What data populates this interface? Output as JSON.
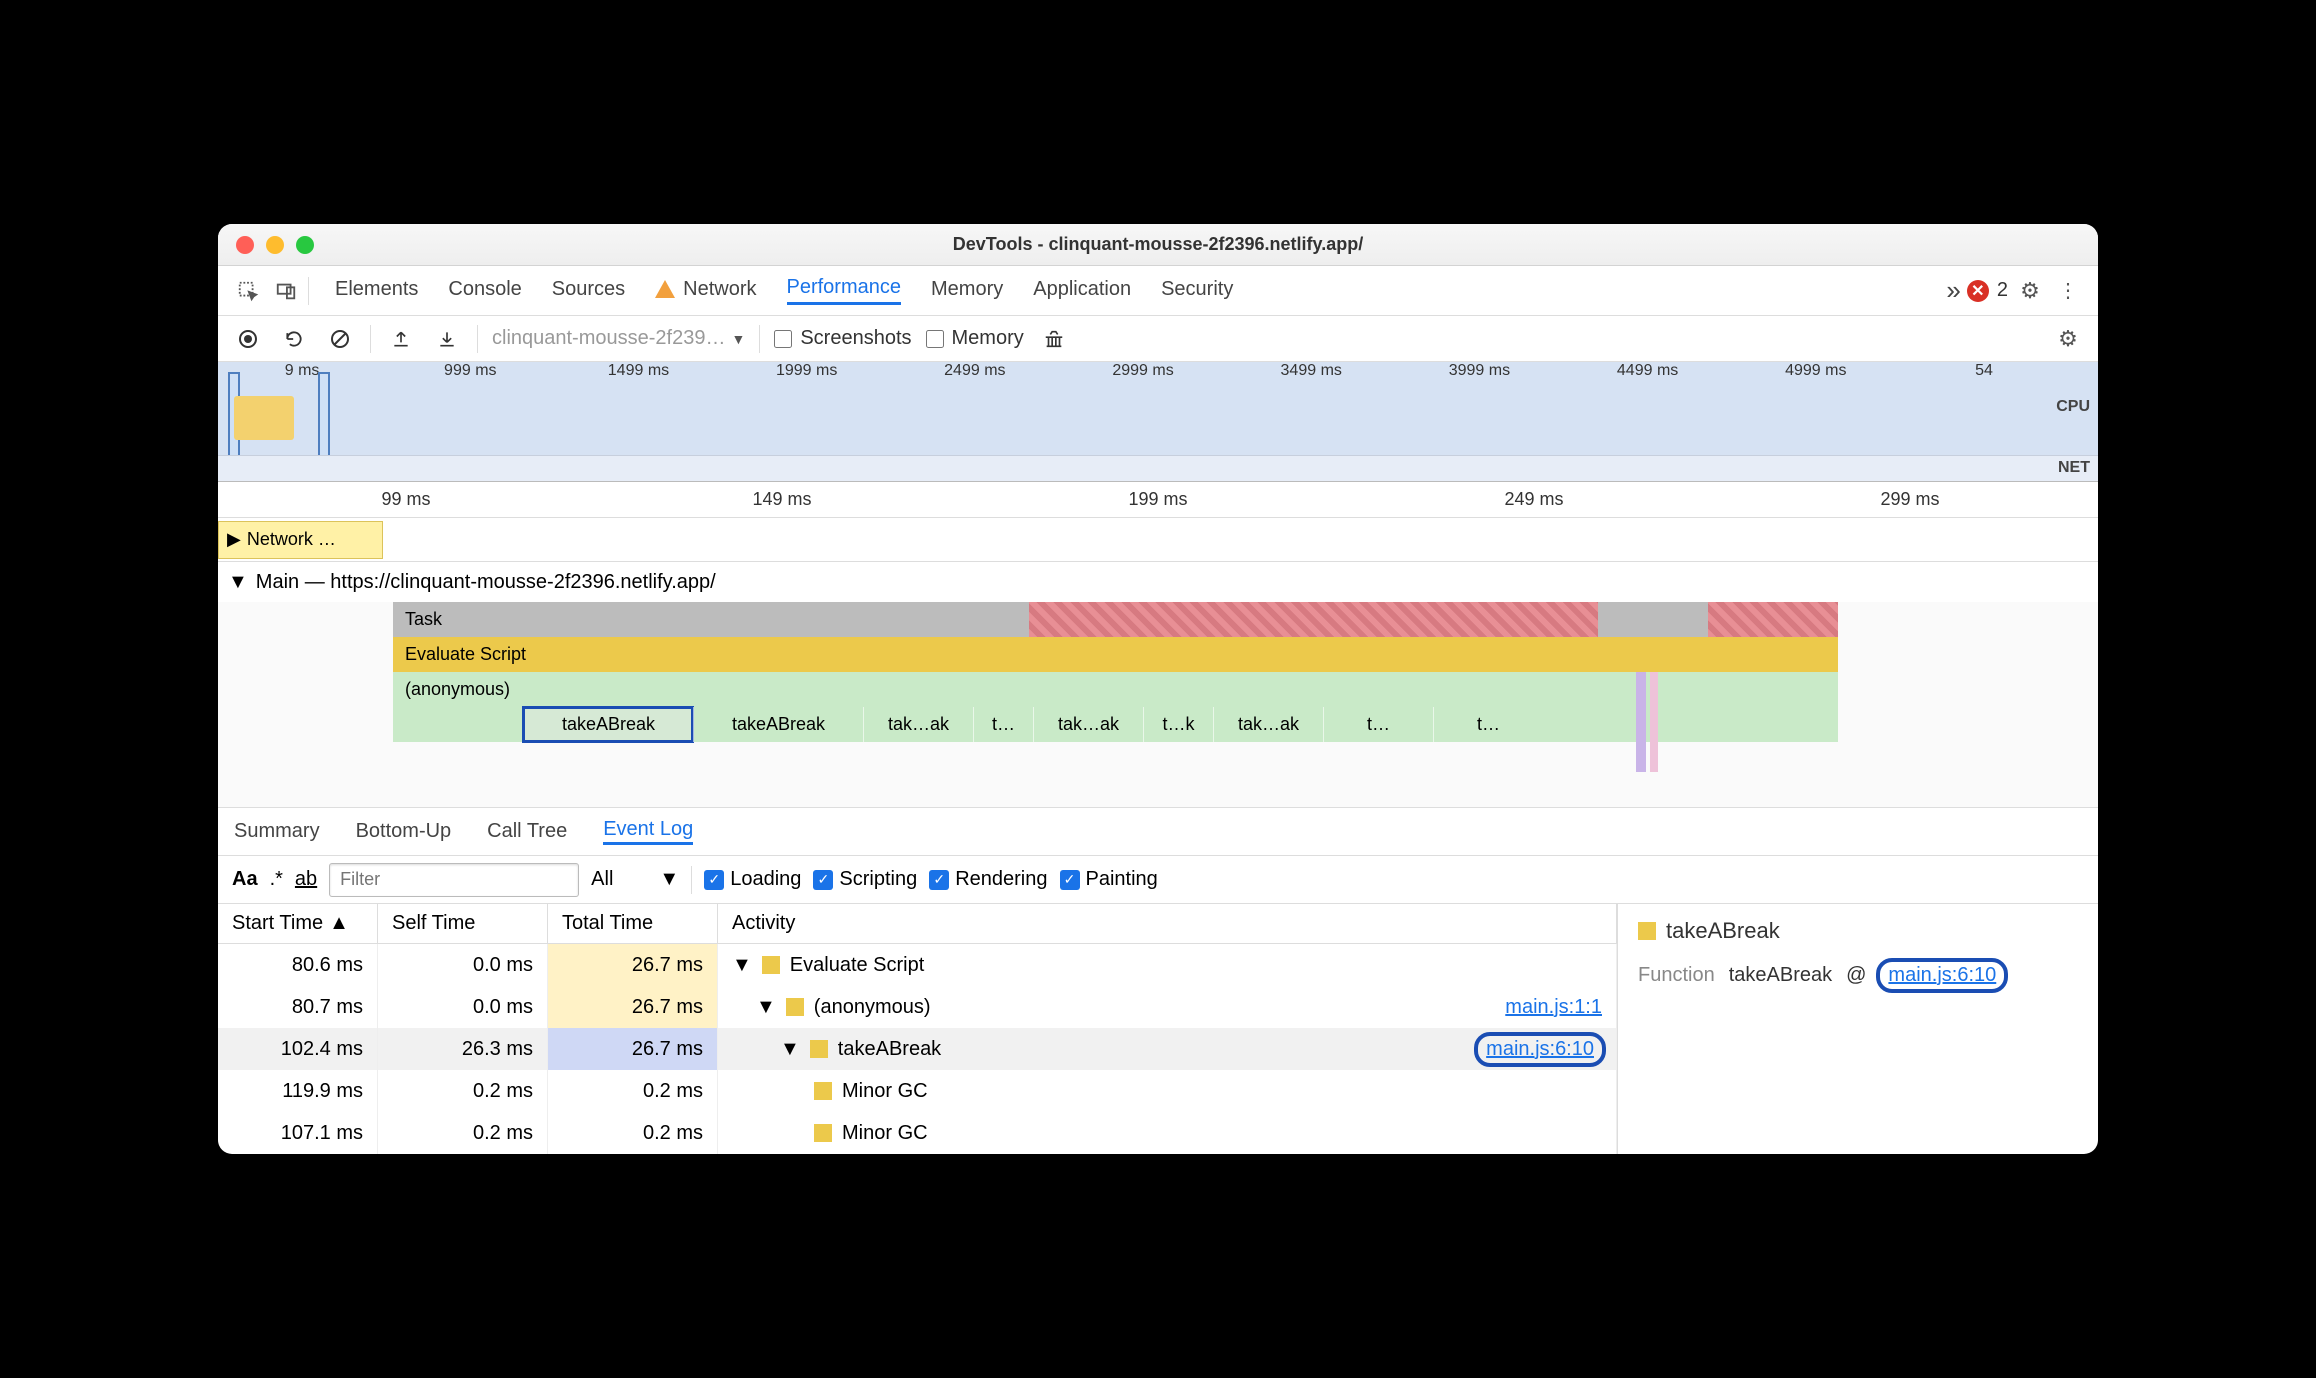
{
  "window": {
    "title": "DevTools - clinquant-mousse-2f2396.netlify.app/"
  },
  "topTabs": {
    "elements": "Elements",
    "console": "Console",
    "sources": "Sources",
    "network": "Network",
    "performance": "Performance",
    "memory": "Memory",
    "application": "Application",
    "security": "Security"
  },
  "errorCount": "2",
  "toolbar": {
    "dropdown": "clinquant-mousse-2f239…",
    "screenshots": "Screenshots",
    "memory": "Memory"
  },
  "overviewTicks": [
    "9 ms",
    "999 ms",
    "1499 ms",
    "1999 ms",
    "2499 ms",
    "2999 ms",
    "3499 ms",
    "3999 ms",
    "4499 ms",
    "4999 ms",
    "54"
  ],
  "overviewLabels": {
    "cpu": "CPU",
    "net": "NET"
  },
  "rulerTicks": [
    "99 ms",
    "149 ms",
    "199 ms",
    "249 ms",
    "299 ms"
  ],
  "network": {
    "label": "Network …"
  },
  "main": {
    "title": "Main — https://clinquant-mousse-2f2396.netlify.app/",
    "task": "Task",
    "eval": "Evaluate Script",
    "anon": "(anonymous)",
    "calls": [
      "takeABreak",
      "takeABreak",
      "tak…ak",
      "t…",
      "tak…ak",
      "t…k",
      "tak…ak",
      "t…",
      "t…"
    ]
  },
  "detailTabs": {
    "summary": "Summary",
    "bottomUp": "Bottom-Up",
    "callTree": "Call Tree",
    "eventLog": "Event Log"
  },
  "filters": {
    "placeholder": "Filter",
    "all": "All",
    "loading": "Loading",
    "scripting": "Scripting",
    "rendering": "Rendering",
    "painting": "Painting"
  },
  "columns": {
    "start": "Start Time",
    "self": "Self Time",
    "total": "Total Time",
    "activity": "Activity"
  },
  "rows": [
    {
      "start": "80.6 ms",
      "self": "0.0 ms",
      "total": "26.7 ms",
      "activity": "Evaluate Script",
      "indent": 0,
      "arrow": true,
      "ttStyle": "hl",
      "link": ""
    },
    {
      "start": "80.7 ms",
      "self": "0.0 ms",
      "total": "26.7 ms",
      "activity": "(anonymous)",
      "indent": 1,
      "arrow": true,
      "ttStyle": "hl",
      "link": "main.js:1:1"
    },
    {
      "start": "102.4 ms",
      "self": "26.3 ms",
      "total": "26.7 ms",
      "activity": "takeABreak",
      "indent": 2,
      "arrow": true,
      "ttStyle": "sel",
      "link": "main.js:6:10",
      "sel": true,
      "linkBox": true
    },
    {
      "start": "119.9 ms",
      "self": "0.2 ms",
      "total": "0.2 ms",
      "activity": "Minor GC",
      "indent": 3,
      "arrow": false,
      "ttStyle": "",
      "link": ""
    },
    {
      "start": "107.1 ms",
      "self": "0.2 ms",
      "total": "0.2 ms",
      "activity": "Minor GC",
      "indent": 3,
      "arrow": false,
      "ttStyle": "",
      "link": ""
    }
  ],
  "detail": {
    "name": "takeABreak",
    "fnLabel": "Function",
    "fnName": "takeABreak",
    "at": "@",
    "link": "main.js:6:10"
  },
  "aa": "Aa",
  "dotstar": ".*",
  "ab": "ab"
}
